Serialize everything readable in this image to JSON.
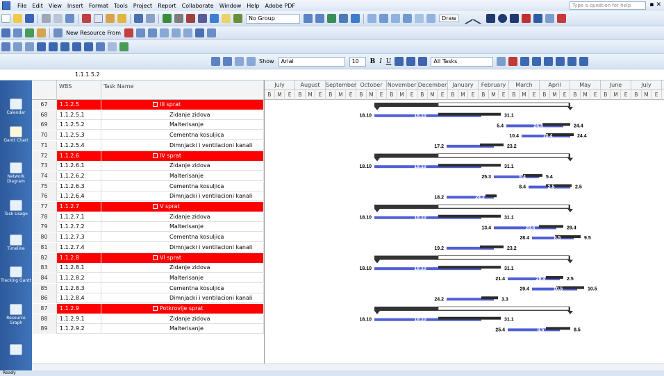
{
  "menu": [
    "File",
    "Edit",
    "View",
    "Insert",
    "Format",
    "Tools",
    "Project",
    "Report",
    "Collaborate",
    "Window",
    "Help",
    "Adobe PDF"
  ],
  "help_placeholder": "Type a question for help",
  "toolbar": {
    "group_value": "No Group",
    "new_resource_from": "New Resource From",
    "draw_label": "Draw",
    "show_label": "Show",
    "font_name": "Arial",
    "font_size": "10",
    "tasks_filter": "All Tasks"
  },
  "entry_value": "1.1.1.5.2",
  "views": [
    {
      "name": "Calendar"
    },
    {
      "name": "Gantt Chart"
    },
    {
      "name": "Network Diagram"
    },
    {
      "name": "Task Usage"
    },
    {
      "name": "Tracking Gantt"
    },
    {
      "name": "Resource Graph"
    }
  ],
  "grid_headers": {
    "wbs": "WBS",
    "task_name": "Task Name"
  },
  "months": [
    "July",
    "August",
    "September",
    "October",
    "November",
    "December",
    "January",
    "February",
    "March",
    "April",
    "May",
    "June",
    "July"
  ],
  "period_letters": [
    "B",
    "M",
    "E"
  ],
  "rows": [
    {
      "num": "67",
      "wbs": "1.1.2.5",
      "name": "III sprat",
      "summary": true
    },
    {
      "num": "68",
      "wbs": "1.1.2.5.1",
      "name": "Zidanje zidova",
      "summary": false
    },
    {
      "num": "69",
      "wbs": "1.1.2.5.2",
      "name": "Malterisanje",
      "summary": false
    },
    {
      "num": "70",
      "wbs": "1.1.2.5.3",
      "name": "Cementna kosuljica",
      "summary": false
    },
    {
      "num": "71",
      "wbs": "1.1.2.5.4",
      "name": "Dimnjacki i ventilacioni kanali",
      "summary": false
    },
    {
      "num": "72",
      "wbs": "1.1.2.6",
      "name": "IV sprat",
      "summary": true
    },
    {
      "num": "73",
      "wbs": "1.1.2.6.1",
      "name": "Zidanje zidova",
      "summary": false
    },
    {
      "num": "74",
      "wbs": "1.1.2.6.2",
      "name": "Malterisanje",
      "summary": false
    },
    {
      "num": "75",
      "wbs": "1.1.2.6.3",
      "name": "Cementna kosuljica",
      "summary": false
    },
    {
      "num": "76",
      "wbs": "1.1.2.6.4",
      "name": "Dimnjacki i ventilacioni kanali",
      "summary": false
    },
    {
      "num": "77",
      "wbs": "1.1.2.7",
      "name": "V sprat",
      "summary": true
    },
    {
      "num": "78",
      "wbs": "1.1.2.7.1",
      "name": "Zidanje zidova",
      "summary": false
    },
    {
      "num": "79",
      "wbs": "1.1.2.7.2",
      "name": "Malterisanje",
      "summary": false
    },
    {
      "num": "80",
      "wbs": "1.1.2.7.3",
      "name": "Cementna kosuljica",
      "summary": false
    },
    {
      "num": "81",
      "wbs": "1.1.2.7.4",
      "name": "Dimnjacki i ventilacioni kanali",
      "summary": false
    },
    {
      "num": "82",
      "wbs": "1.1.2.8",
      "name": "VI sprat",
      "summary": true
    },
    {
      "num": "83",
      "wbs": "1.1.2.8.1",
      "name": "Zidanje zidova",
      "summary": false
    },
    {
      "num": "84",
      "wbs": "1.1.2.8.2",
      "name": "Malterisanje",
      "summary": false
    },
    {
      "num": "85",
      "wbs": "1.1.2.8.3",
      "name": "Cementna kosuljica",
      "summary": false
    },
    {
      "num": "86",
      "wbs": "1.1.2.8.4",
      "name": "Dimnjacki i ventilacioni kanali",
      "summary": false
    },
    {
      "num": "87",
      "wbs": "1.1.2.9",
      "name": "Potkrovlje sprat",
      "summary": true
    },
    {
      "num": "88",
      "wbs": "1.1.2.9.1",
      "name": "Zidanje zidova",
      "summary": false
    },
    {
      "num": "89",
      "wbs": "1.1.2.9.2",
      "name": "Malterisanje",
      "summary": false
    }
  ],
  "gantt_labels": [
    {
      "row": 1,
      "left": "18.10",
      "mid": "18.10",
      "right": "31.1"
    },
    {
      "row": 2,
      "left": "5.4",
      "mid": "24.4",
      "right": "24.4"
    },
    {
      "row": 3,
      "left": "10.4",
      "mid": "10.4",
      "right": "24.4"
    },
    {
      "row": 4,
      "left": "17.2",
      "mid": "",
      "right": "23.2"
    },
    {
      "row": 6,
      "left": "18.10",
      "mid": "18.10",
      "right": "31.1"
    },
    {
      "row": 7,
      "left": "25.3",
      "mid": "5.4",
      "right": "5.4"
    },
    {
      "row": 8,
      "left": "8.4",
      "mid": "2.5",
      "right": "2.5"
    },
    {
      "row": 9,
      "left": "18.2",
      "mid": "24.2",
      "right": ""
    },
    {
      "row": 11,
      "left": "18.10",
      "mid": "18.10",
      "right": "31.1"
    },
    {
      "row": 12,
      "left": "13.4",
      "mid": "28.4",
      "right": "29.4"
    },
    {
      "row": 13,
      "left": "28.4",
      "mid": "8.5",
      "right": "9.5"
    },
    {
      "row": 14,
      "left": "19.2",
      "mid": "",
      "right": "23.2"
    },
    {
      "row": 16,
      "left": "18.10",
      "mid": "18.10",
      "right": "31.1"
    },
    {
      "row": 17,
      "left": "21.4",
      "mid": "28.4",
      "right": "2.5"
    },
    {
      "row": 18,
      "left": "29.4",
      "mid": "10.5",
      "right": "10.5"
    },
    {
      "row": 19,
      "left": "24.2",
      "mid": "",
      "right": "3.3"
    },
    {
      "row": 21,
      "left": "18.10",
      "mid": "18.10",
      "right": "31.1"
    },
    {
      "row": 22,
      "left": "25.4",
      "mid": "8.5",
      "right": "8.5"
    }
  ],
  "status_text": "Ready",
  "colors": {
    "summary_red": "#ff0000",
    "bar_blue": "#4f5fd6",
    "bar_black": "#2b2b2b"
  }
}
